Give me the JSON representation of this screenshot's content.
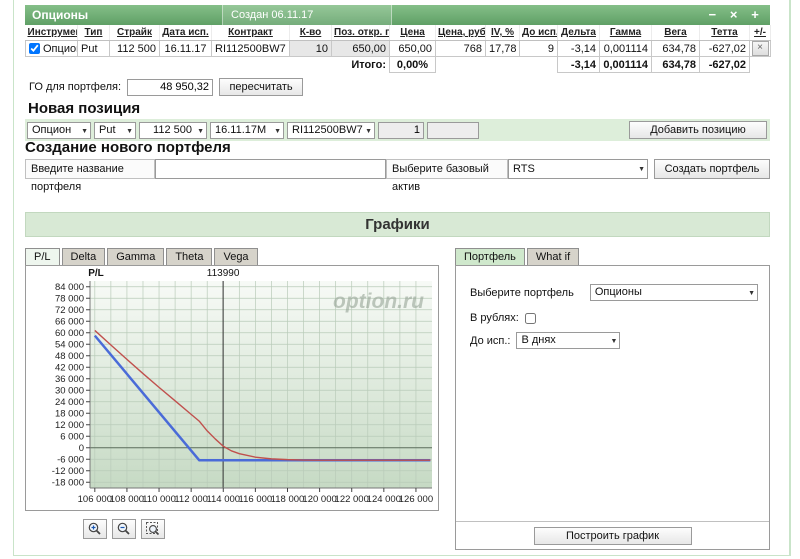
{
  "window": {
    "title": "Опционы",
    "created": "Создан 06.11.17",
    "controls": {
      "minimize": "−",
      "close": "×",
      "add": "+"
    }
  },
  "positions_table": {
    "headers": [
      "Инструмент",
      "Тип",
      "Страйк",
      "Дата исп.",
      "Контракт",
      "К-во",
      "Поз. откр. по",
      "Цена",
      "Цена, руб.",
      "IV, %",
      "До исп.",
      "Дельта",
      "Гамма",
      "Вега",
      "Тетта",
      "+/-"
    ],
    "row": {
      "instrument": "Опцион",
      "type": "Put",
      "strike": "112 500",
      "exp_date": "16.11.17",
      "contract": "RI112500BW7",
      "qty": "10",
      "pos_open": "650,00",
      "price": "650,00",
      "price_rub": "768",
      "iv": "17,78",
      "days": "9",
      "delta": "-3,14",
      "gamma": "0,001114",
      "vega": "634,78",
      "theta": "-627,02",
      "delete": "×"
    },
    "totals": {
      "label": "Итого:",
      "price_pct": "0,00%",
      "delta": "-3,14",
      "gamma": "0,001114",
      "vega": "634,78",
      "theta": "-627,02"
    }
  },
  "go": {
    "label": "ГО для портфеля:",
    "value": "48 950,32",
    "recalc_button": "пересчитать"
  },
  "new_position": {
    "title": "Новая позиция",
    "instrument": "Опцион",
    "type": "Put",
    "strike": "112 500",
    "exp": "16.11.17M",
    "contract": "RI112500BW7",
    "qty": "1",
    "add_button": "Добавить позицию"
  },
  "new_portfolio": {
    "title": "Создание нового портфеля",
    "name_label": "Введите название портфеля",
    "asset_label": "Выберите базовый актив",
    "asset_value": "RTS",
    "create_button": "Создать портфель"
  },
  "charts_section": {
    "title": "Графики"
  },
  "chart_tabs": [
    "P/L",
    "Delta",
    "Gamma",
    "Theta",
    "Vega"
  ],
  "right_tabs": [
    "Портфель",
    "What if"
  ],
  "right_panel": {
    "portfolio_label": "Выберите портфель",
    "portfolio_value": "Опционы",
    "rub_label": "В рублях:",
    "days_label": "До исп.:",
    "days_value": "В днях",
    "build_button": "Построить график"
  },
  "chart_data": {
    "type": "line",
    "ylabel": "P/L",
    "watermark": "option.ru",
    "xlim": [
      105700,
      127000
    ],
    "ylim": [
      -21000,
      87000
    ],
    "x_grid_step": 1000,
    "x_grid_range": [
      106000,
      126000
    ],
    "x_tick_values": [
      106000,
      108000,
      110000,
      112000,
      114000,
      116000,
      118000,
      120000,
      122000,
      124000,
      126000
    ],
    "x_tick_labels": [
      "106 000",
      "108 000",
      "110 000",
      "112 000",
      "114 000",
      "116 000",
      "118 000",
      "120 000",
      "122 000",
      "124 000",
      "126 000"
    ],
    "y_tick_values": [
      84000,
      78000,
      72000,
      66000,
      60000,
      54000,
      48000,
      42000,
      36000,
      30000,
      24000,
      18000,
      12000,
      6000,
      0,
      -6000,
      -12000,
      -18000
    ],
    "y_tick_labels": [
      "84 000",
      "78 000",
      "72 000",
      "66 000",
      "60 000",
      "54 000",
      "48 000",
      "42 000",
      "36 000",
      "30 000",
      "24 000",
      "18 000",
      "12 000",
      "6 000",
      "0",
      "-6 000",
      "-12 000",
      "-18 000"
    ],
    "marker": {
      "value": 113990,
      "label": "113990",
      "color": "#333333"
    },
    "zero_line": {
      "value": 0,
      "color": "#5d6e5d"
    },
    "bg_top": "#f7faf6",
    "bg_bottom": "#c6dac4",
    "grid_color": "#b9cbb9",
    "series": [
      {
        "name": "expiration-pl",
        "color": "#4a6bd8",
        "width": 2.5,
        "points": [
          [
            106000,
            58500
          ],
          [
            112500,
            -6500
          ],
          [
            126900,
            -6500
          ]
        ]
      },
      {
        "name": "current-pl",
        "color": "#c0504d",
        "width": 1.4,
        "points": [
          [
            106000,
            61200
          ],
          [
            107000,
            53600
          ],
          [
            108000,
            46100
          ],
          [
            109000,
            38700
          ],
          [
            110000,
            31500
          ],
          [
            111000,
            24500
          ],
          [
            112000,
            17400
          ],
          [
            112500,
            13900
          ],
          [
            113000,
            8800
          ],
          [
            113500,
            4600
          ],
          [
            114000,
            800
          ],
          [
            114500,
            -1600
          ],
          [
            115000,
            -3100
          ],
          [
            116000,
            -4900
          ],
          [
            117000,
            -5800
          ],
          [
            118000,
            -6200
          ],
          [
            119000,
            -6400
          ],
          [
            120000,
            -6500
          ],
          [
            126900,
            -6500
          ]
        ]
      }
    ]
  }
}
